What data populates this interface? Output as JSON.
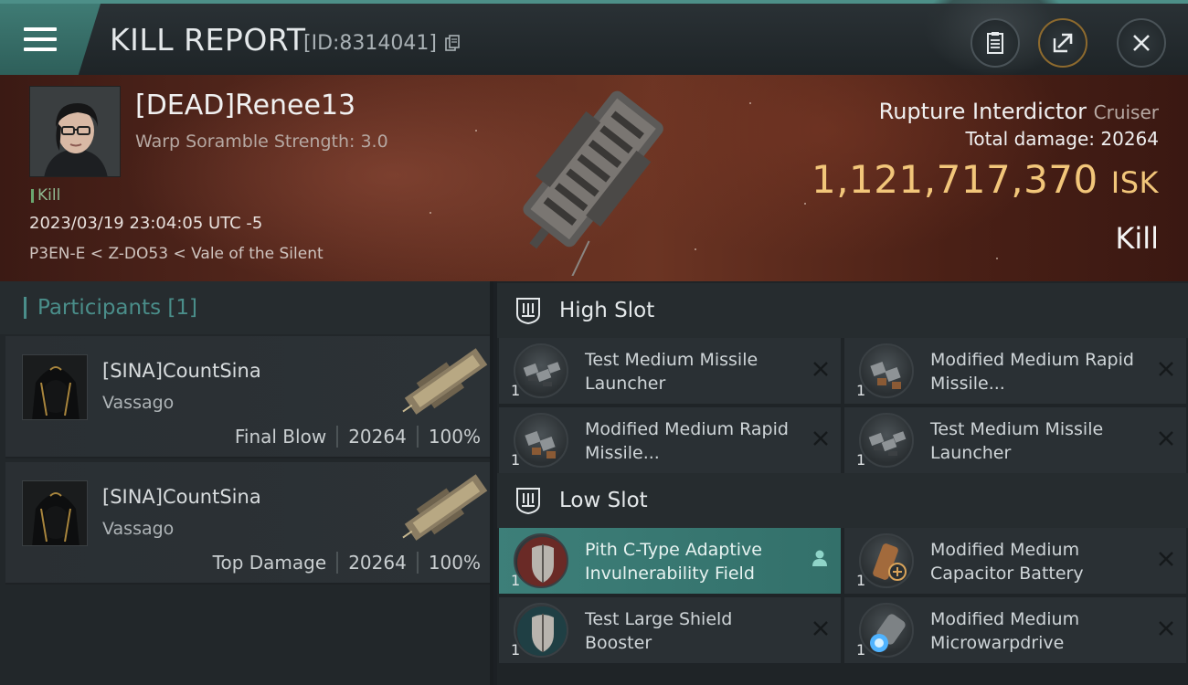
{
  "header": {
    "title": "KILL REPORT",
    "id_text": "[ID:8314041]",
    "icons": [
      "menu-icon",
      "copy-icon",
      "clipboard-icon",
      "share-icon",
      "close-icon"
    ]
  },
  "victim": {
    "name": "[DEAD]Renee13",
    "warp_scramble": "Warp Soramble Strength: 3.0",
    "tag": "Kill",
    "datetime": "2023/03/19 23:04:05 UTC -5",
    "location": "P3EN-E < Z-DO53 < Vale of the Silent",
    "ship_name": "Rupture Interdictor",
    "ship_class": "Cruiser",
    "total_damage_label": "Total damage:",
    "total_damage": "20264",
    "isk_value": "1,121,717,370",
    "isk_unit": "ISK",
    "result": "Kill"
  },
  "participants": {
    "title": "Participants",
    "count": "[1]",
    "list": [
      {
        "name": "[SINA]CountSina",
        "ship": "Vassago",
        "role": "Final Blow",
        "damage": "20264",
        "percent": "100%"
      },
      {
        "name": "[SINA]CountSina",
        "ship": "Vassago",
        "role": "Top Damage",
        "damage": "20264",
        "percent": "100%"
      }
    ]
  },
  "fitting": {
    "high_slot_label": "High Slot",
    "low_slot_label": "Low Slot",
    "high_slot": [
      {
        "name": "Test Medium Missile Launcher",
        "qty": "1"
      },
      {
        "name": "Modified Medium Rapid Missile...",
        "qty": "1"
      },
      {
        "name": "Modified Medium Rapid Missile...",
        "qty": "1"
      },
      {
        "name": "Test Medium Missile Launcher",
        "qty": "1"
      }
    ],
    "low_slot": [
      {
        "name": "Pith C-Type Adaptive Invulnerability Field",
        "qty": "1"
      },
      {
        "name": "Modified Medium Capacitor Battery",
        "qty": "1"
      },
      {
        "name": "Test Large Shield Booster",
        "qty": "1"
      },
      {
        "name": "Modified Medium Microwarpdrive",
        "qty": "1"
      }
    ]
  },
  "colors": {
    "accent_teal": "#3d7f79",
    "isk_gold": "#f2c67a",
    "kill_green": "#6aa66f"
  }
}
